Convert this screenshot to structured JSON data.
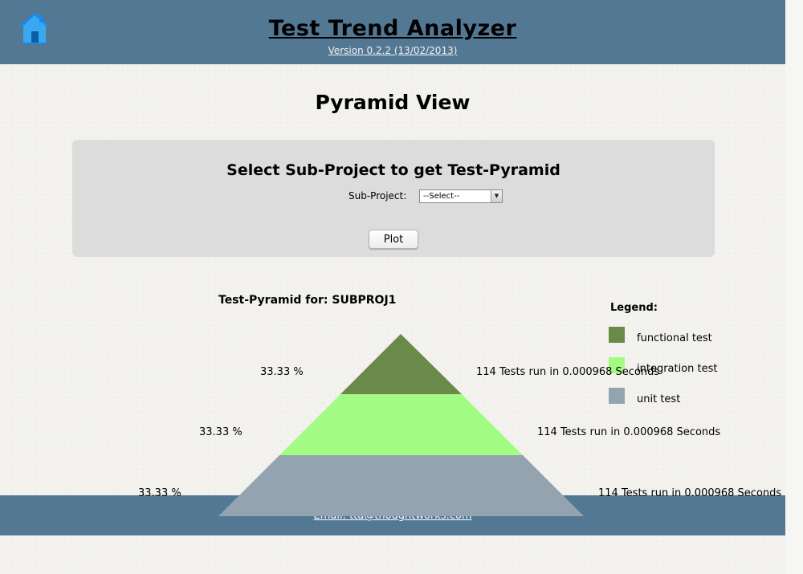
{
  "header": {
    "title": "Test Trend Analyzer",
    "version": "Version 0.2.2 (13/02/2013)",
    "home_icon": "home-icon"
  },
  "page": {
    "title": "Pyramid View"
  },
  "selector": {
    "heading": "Select Sub-Project to get Test-Pyramid",
    "sub_project_label": "Sub-Project:",
    "select_value": "--Select--",
    "plot_button": "Plot"
  },
  "pyramid": {
    "title": "Test-Pyramid for: SUBPROJ1",
    "layers": [
      {
        "name": "functional test",
        "percent": "33.33 %",
        "tests": "114 Tests run in 0.000968 Seconds",
        "color": "#6a8a4a"
      },
      {
        "name": "integration test",
        "percent": "33.33 %",
        "tests": "114 Tests run in 0.000968 Seconds",
        "color": "#a2fc83"
      },
      {
        "name": "unit test",
        "percent": "33.33 %",
        "tests": "114 Tests run in 0.000968 Seconds",
        "color": "#93a3b0"
      }
    ],
    "legend_title": "Legend:"
  },
  "footer": {
    "email": "Email: tta@thoughtworks.com"
  },
  "colors": {
    "header_bg": "#537893",
    "panel_bg": "#dcdcdc",
    "home_icon_blue": "#2a8fe0"
  }
}
